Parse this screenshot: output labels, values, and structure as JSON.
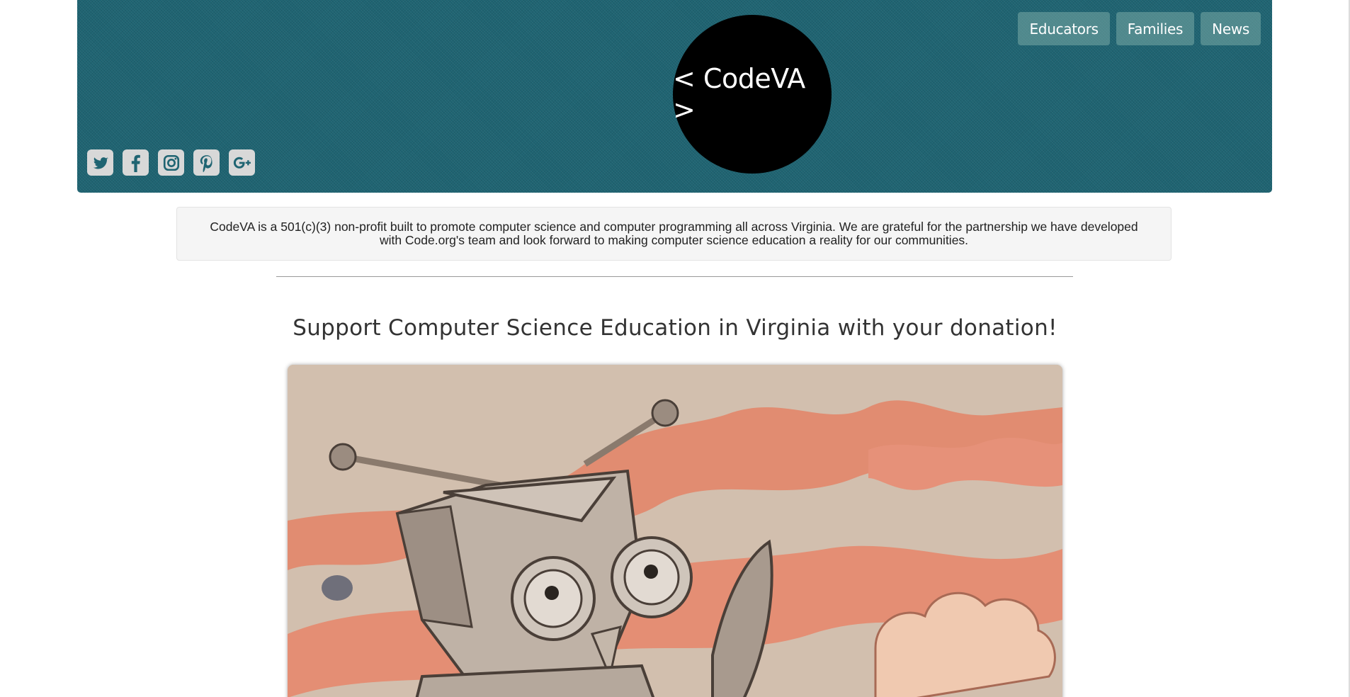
{
  "header": {
    "logo_text": "< CodeVA >",
    "nav": [
      {
        "label": "Educators"
      },
      {
        "label": "Families"
      },
      {
        "label": "News"
      }
    ],
    "social_icons": [
      "twitter-icon",
      "facebook-icon",
      "instagram-icon",
      "pinterest-icon",
      "google-plus-icon"
    ]
  },
  "intro": {
    "text": "CodeVA is a 501(c)(3) non-profit built to promote computer science and computer programming all across Virginia. We are grateful for the partnership we have developed with Code.org's team and look forward to making computer science education a reality for our communities."
  },
  "donation": {
    "headline": "Support Computer Science Education in Virginia with your donation!"
  },
  "colors": {
    "banner": "#1f6472",
    "nav_button": "#6fa4a0",
    "logo_circle": "#000000",
    "well_bg": "#f5f5f5"
  }
}
